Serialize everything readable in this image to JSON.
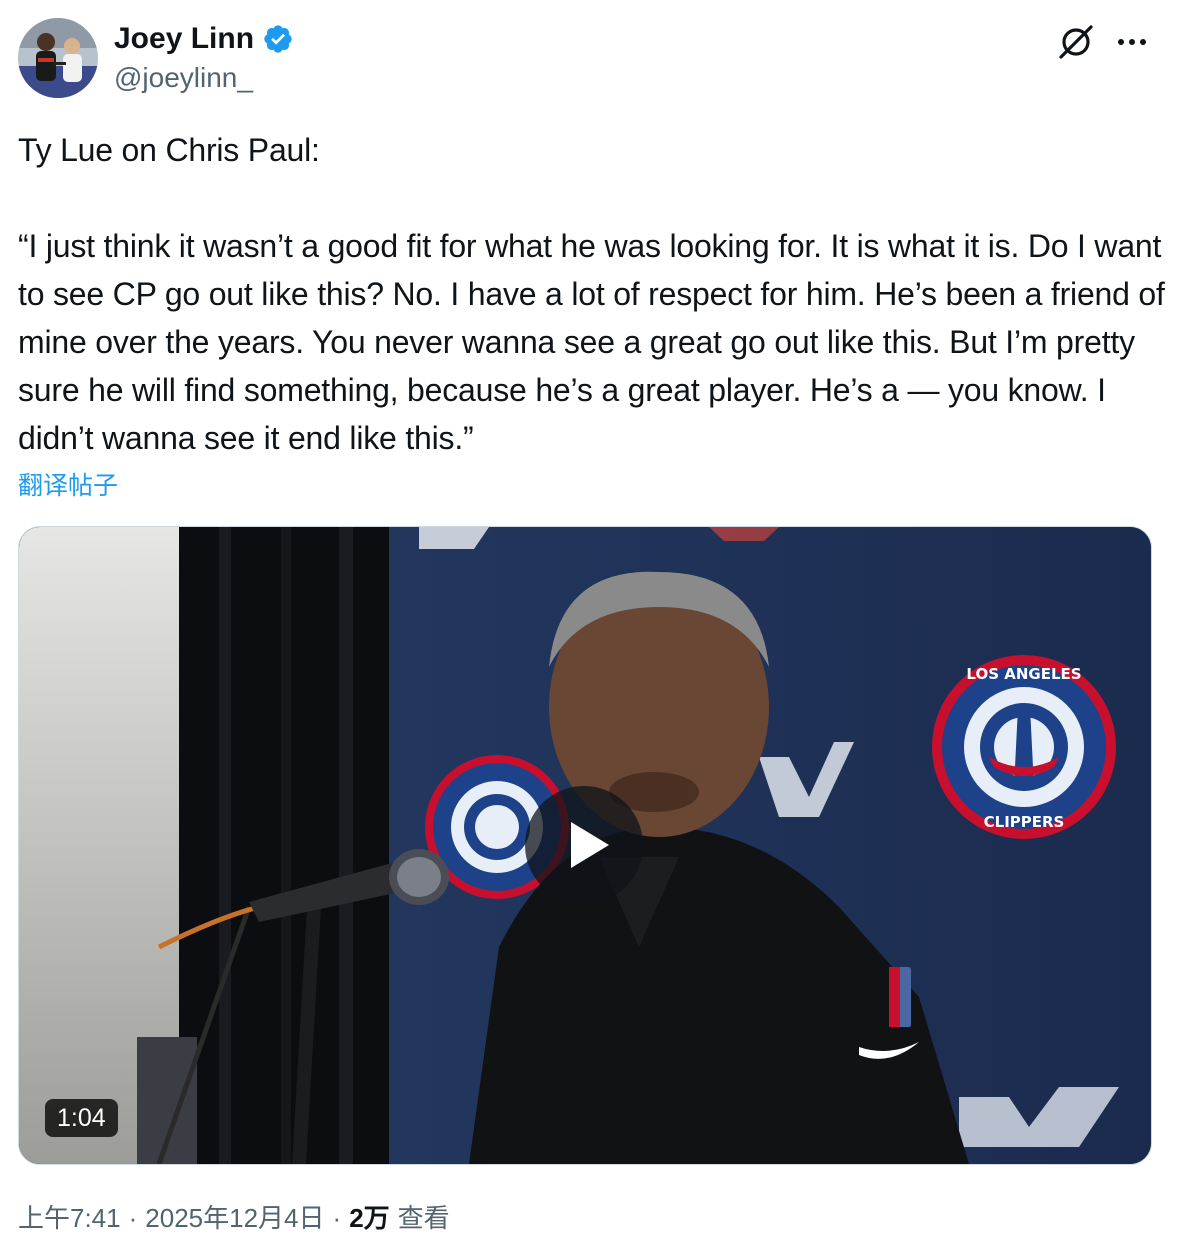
{
  "author": {
    "display_name": "Joey Linn",
    "handle": "@joeylinn_",
    "verified": true
  },
  "tweet": {
    "text": "Ty Lue on Chris Paul:\n\n“I just think it wasn’t a good fit for what he was looking for. It is what it is. Do I want to see CP go out like this? No. I have a lot of respect for him. He’s been a friend of mine over the years. You never wanna see a great go out like this. But I’m pretty sure he will find something, because he’s a great player. He’s a — you know. I didn’t wanna see it end like this.”",
    "translate_label": "翻译帖子"
  },
  "media": {
    "duration": "1:04",
    "logo_text_top": "LOS ANGELES",
    "logo_text_bottom": "CLIPPERS"
  },
  "meta": {
    "time": "上午7:41",
    "date": "2025年12月4日",
    "separator": "·",
    "views_count": "2万",
    "views_label": "查看"
  },
  "colors": {
    "accent": "#1d9bf0",
    "text_primary": "#0f1419",
    "text_secondary": "#536471",
    "verified_badge": "#1d9bf0"
  },
  "icons": {
    "verified": "verified-badge-icon",
    "grok": "grok-icon",
    "more": "more-dots-icon",
    "play": "play-icon"
  }
}
